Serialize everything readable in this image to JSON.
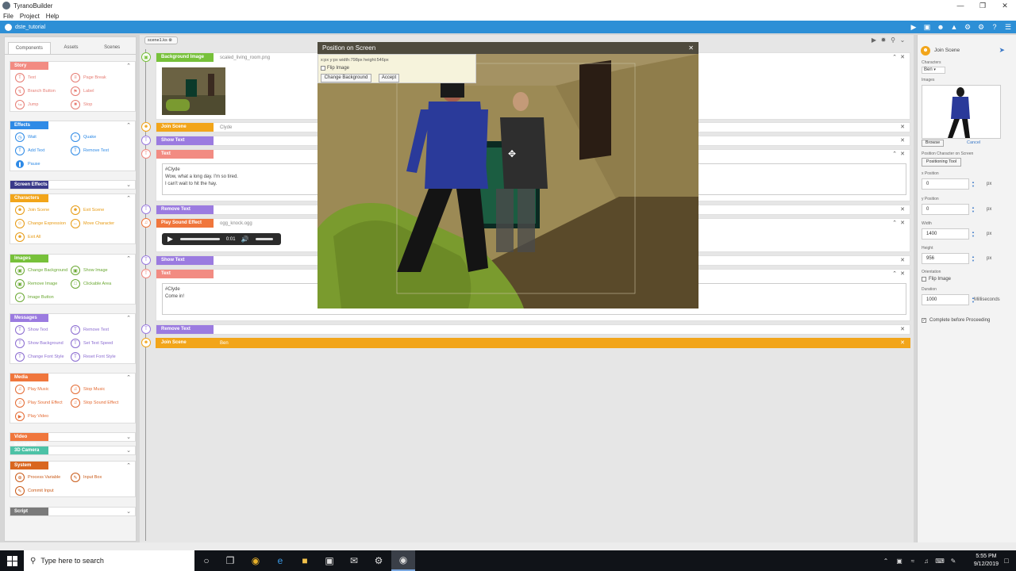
{
  "window": {
    "title": "TyranoBuilder"
  },
  "menu": [
    "File",
    "Project",
    "Help"
  ],
  "project": {
    "name": "dste_tutorial"
  },
  "left": {
    "tabs": [
      "Components",
      "Assets",
      "Scenes"
    ],
    "categories": [
      {
        "name": "Story",
        "items": [
          "Text",
          "Page Break",
          "Branch Button",
          "Label",
          "Jump",
          "Stop"
        ]
      },
      {
        "name": "Effects",
        "items": [
          "Wait",
          "Quake",
          "Add Text",
          "Remove Text",
          "Pause"
        ]
      },
      {
        "name": "Screen Effects"
      },
      {
        "name": "Characters",
        "items": [
          "Join Scene",
          "Exit Scene",
          "Change Expression",
          "Move Character",
          "Exit All"
        ]
      },
      {
        "name": "Images",
        "items": [
          "Change Background",
          "Show Image",
          "Remove Image",
          "Clickable Area",
          "Image Button"
        ]
      },
      {
        "name": "Messages",
        "items": [
          "Show Text",
          "Remove Text",
          "Show Background",
          "Set Text Speed",
          "Change Font Style",
          "Reset Font Style"
        ]
      },
      {
        "name": "Media",
        "items": [
          "Play Music",
          "Stop Music",
          "Play Sound Effect",
          "Stop Sound Effect",
          "Play Video"
        ]
      },
      {
        "name": "Video Backdrop"
      },
      {
        "name": "3D Camera"
      },
      {
        "name": "System",
        "items": [
          "Process Variable",
          "Input Box",
          "Commit Input"
        ]
      },
      {
        "name": "Script"
      }
    ]
  },
  "editor": {
    "scene_tab": "scene1.ks",
    "rows": [
      {
        "label": "Background Image",
        "value": "scaled_living_room.png"
      },
      {
        "label": "Join Scene",
        "value": "Clyde"
      },
      {
        "label": "Show Text",
        "value": ""
      },
      {
        "label": "Text",
        "value": "",
        "content": "#Clyde\nWow, what a long day. I'm so tired.\nI can't wait to hit the hay."
      },
      {
        "label": "Remove Text",
        "value": ""
      },
      {
        "label": "Play Sound Effect",
        "value": "ogg_knock.ogg",
        "audio_time": "0:01"
      },
      {
        "label": "Show Text",
        "value": ""
      },
      {
        "label": "Text",
        "value": "",
        "content": "#Clyde\nCome in!"
      },
      {
        "label": "Remove Text",
        "value": ""
      },
      {
        "label": "Join Scene",
        "value": "Ben"
      }
    ]
  },
  "dialog": {
    "title": "Position on Screen",
    "coords": "x:px y:px width:798px height:546px",
    "flip_label": "Flip Image",
    "change_bg": "Change Background",
    "accept": "Accept"
  },
  "right": {
    "title": "Join Scene",
    "characters_label": "Characters",
    "character": "Ben",
    "images_label": "Images",
    "browse": "Browse",
    "cancel": "Cancel",
    "position_label": "Position Character on Screen",
    "positioning_tool": "Positioning Tool",
    "x_label": "x Position",
    "x_value": "0",
    "y_label": "y Position",
    "y_value": "0",
    "width_label": "Width",
    "width_value": "1400",
    "height_label": "Height",
    "height_value": "956",
    "px": "px",
    "orientation_label": "Orientation",
    "flip_label": "Flip Image",
    "duration_label": "Duration",
    "duration_value": "1000",
    "ms": "Milliseconds",
    "complete_label": "Complete before Proceeding"
  },
  "taskbar": {
    "search_placeholder": "Type here to search",
    "time": "5:55 PM",
    "date": "9/12/2019"
  },
  "colors": {
    "story": "#f28b82",
    "effects": "#2e8ae6",
    "screen": "#3a3a8a",
    "characters": "#f2a51a",
    "images": "#77c13a",
    "messages": "#9b7be0",
    "media": "#f0763c",
    "video": "#f0763c",
    "camera": "#4cc2a6",
    "system": "#d9661f",
    "script": "#7a7a7a"
  }
}
